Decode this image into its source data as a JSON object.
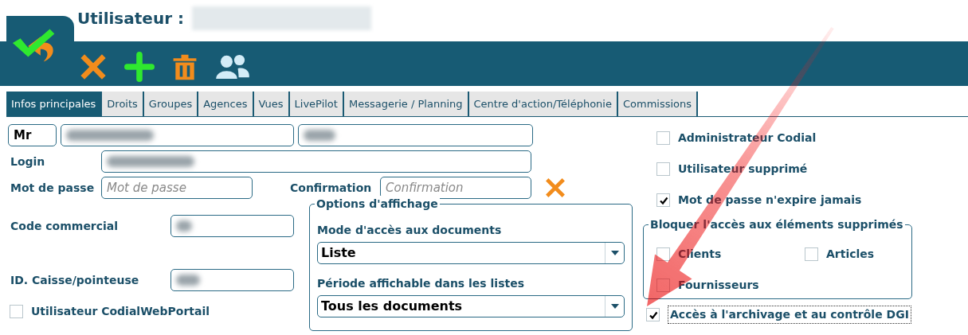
{
  "header": {
    "title": "Utilisateur :",
    "name_obscured": true
  },
  "tabs": [
    {
      "label": "Infos principales",
      "selected": true
    },
    {
      "label": "Droits",
      "selected": false
    },
    {
      "label": "Groupes",
      "selected": false
    },
    {
      "label": "Agences",
      "selected": false
    },
    {
      "label": "Vues",
      "selected": false
    },
    {
      "label": "LivePilot",
      "selected": false
    },
    {
      "label": "Messagerie / Planning",
      "selected": false
    },
    {
      "label": "Centre d'action/Téléphonie",
      "selected": false
    },
    {
      "label": "Commissions",
      "selected": false
    }
  ],
  "identity": {
    "civility": "Mr",
    "last_name_obscured": true,
    "first_name_obscured": true
  },
  "login": {
    "label": "Login",
    "obscured": true
  },
  "password": {
    "label": "Mot de passe",
    "placeholder": "Mot de passe"
  },
  "confirmation": {
    "label": "Confirmation",
    "placeholder": "Confirmation"
  },
  "code_commercial": {
    "label": "Code commercial",
    "obscured": true
  },
  "id_caisse": {
    "label": "ID. Caisse/pointeuse",
    "obscured": true
  },
  "web_portal": {
    "label": "Utilisateur CodialWebPortail",
    "checked": false
  },
  "display_options": {
    "title": "Options d'affichage",
    "selects": [
      {
        "label": "Mode d'accès aux documents",
        "value": "Liste"
      },
      {
        "label": "Période affichable dans les listes",
        "value": "Tous les documents"
      }
    ]
  },
  "flags": [
    {
      "label": "Administrateur Codial",
      "checked": false
    },
    {
      "label": "Utilisateur supprimé",
      "checked": false
    },
    {
      "label": "Mot de passe n'expire jamais",
      "checked": true
    }
  ],
  "block_deleted": {
    "title": "Bloquer l'accès aux éléments supprimés",
    "items": [
      {
        "label": "Clients",
        "checked": false
      },
      {
        "label": "Articles",
        "checked": false
      },
      {
        "label": "Fournisseurs",
        "checked": false
      }
    ]
  },
  "archive": {
    "label": "Accès à l'archivage et au contrôle DGI",
    "checked": true,
    "focused": true
  }
}
